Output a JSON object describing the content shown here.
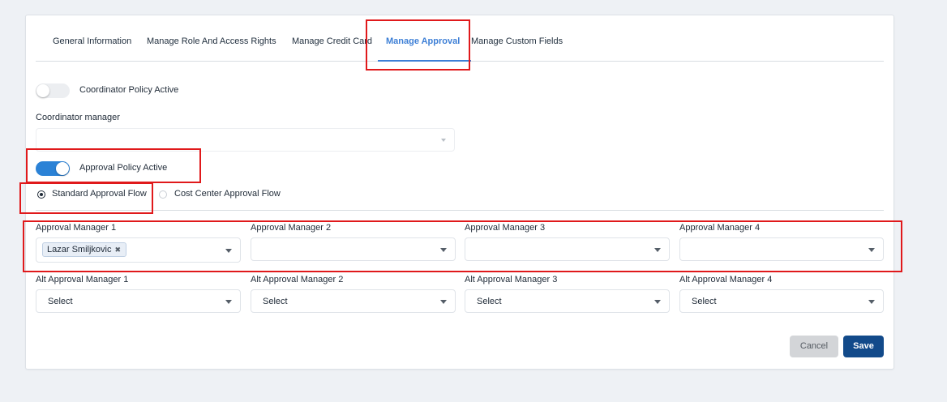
{
  "tabs": [
    {
      "label": "General Information"
    },
    {
      "label": "Manage Role And Access Rights"
    },
    {
      "label": "Manage Credit Card"
    },
    {
      "label": "Manage Approval"
    },
    {
      "label": "Manage Custom Fields"
    }
  ],
  "active_tab": "Manage Approval",
  "coordinator": {
    "toggle_label": "Coordinator Policy Active",
    "toggle_on": false,
    "manager_label": "Coordinator manager",
    "manager_value": ""
  },
  "approval": {
    "toggle_label": "Approval Policy Active",
    "toggle_on": true,
    "flow_options": [
      {
        "label": "Standard Approval Flow",
        "checked": true
      },
      {
        "label": "Cost Center Approval Flow",
        "checked": false
      }
    ]
  },
  "managers": [
    {
      "label": "Approval Manager 1",
      "chip": "Lazar Smiljkovic"
    },
    {
      "label": "Approval Manager 2",
      "value": ""
    },
    {
      "label": "Approval Manager 3",
      "value": ""
    },
    {
      "label": "Approval Manager 4",
      "value": ""
    }
  ],
  "alt_managers": [
    {
      "label": "Alt Approval Manager 1",
      "value": "Select"
    },
    {
      "label": "Alt Approval Manager 2",
      "value": "Select"
    },
    {
      "label": "Alt Approval Manager 3",
      "value": "Select"
    },
    {
      "label": "Alt Approval Manager 4",
      "value": "Select"
    }
  ],
  "buttons": {
    "cancel": "Cancel",
    "save": "Save"
  },
  "colors": {
    "accent": "#3d7fd6",
    "toggle_on": "#2b82d6",
    "save": "#124a8a",
    "highlight": "#e0191b"
  },
  "icons": {
    "chip_remove": "close-icon",
    "dropdown": "chevron-down-icon"
  }
}
